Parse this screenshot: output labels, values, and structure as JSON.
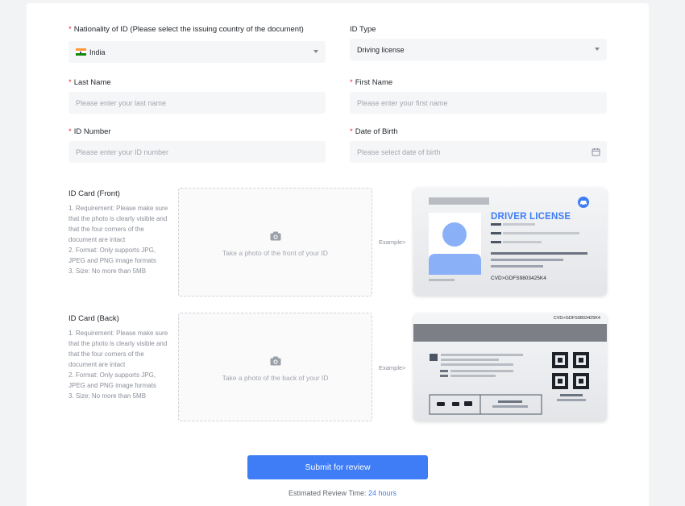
{
  "form": {
    "nationality": {
      "label": "Nationality of ID (Please select the issuing country of the document)",
      "required": "*",
      "value": "India"
    },
    "id_type": {
      "label": "ID Type",
      "value": "Driving license"
    },
    "last_name": {
      "label": "Last Name",
      "required": "*",
      "placeholder": "Please enter your last name"
    },
    "first_name": {
      "label": "First Name",
      "required": "*",
      "placeholder": "Please enter your first name"
    },
    "id_number": {
      "label": "ID Number",
      "required": "*",
      "placeholder": "Please enter your ID number"
    },
    "dob": {
      "label": "Date of Birth",
      "required": "*",
      "placeholder": "Please select date of birth"
    }
  },
  "uploads": {
    "front": {
      "title": "ID Card (Front)",
      "requirements": [
        "1. Requirement: Please make sure that the photo is clearly visible and that the four corners of the document are intact",
        "2. Format: Only supports JPG, JPEG and PNG image formats",
        "3. Size: No more than 5MB"
      ],
      "prompt": "Take a photo of the front of your ID",
      "example_label": "Example>"
    },
    "back": {
      "title": "ID Card (Back)",
      "requirements": [
        "1. Requirement: Please make sure that the photo is clearly visible and that the four corners of the document are intact",
        "2. Format: Only supports JPG, JPEG and PNG image formats",
        "3. Size: No more than 5MB"
      ],
      "prompt": "Take a photo of the back of your ID",
      "example_label": "Example>"
    }
  },
  "sample_front": {
    "heading": "DRIVER LICENSE",
    "code": "CVD>GDFS9803425K4"
  },
  "sample_back": {
    "code": "CVD>GDFS9803425K4"
  },
  "submit": {
    "label": "Submit for review"
  },
  "review": {
    "prefix": "Estimated Review Time:",
    "value": "24 hours"
  },
  "colors": {
    "accent": "#3e7df5",
    "required": "#f5222d",
    "avatar": "#8ab1f8"
  }
}
